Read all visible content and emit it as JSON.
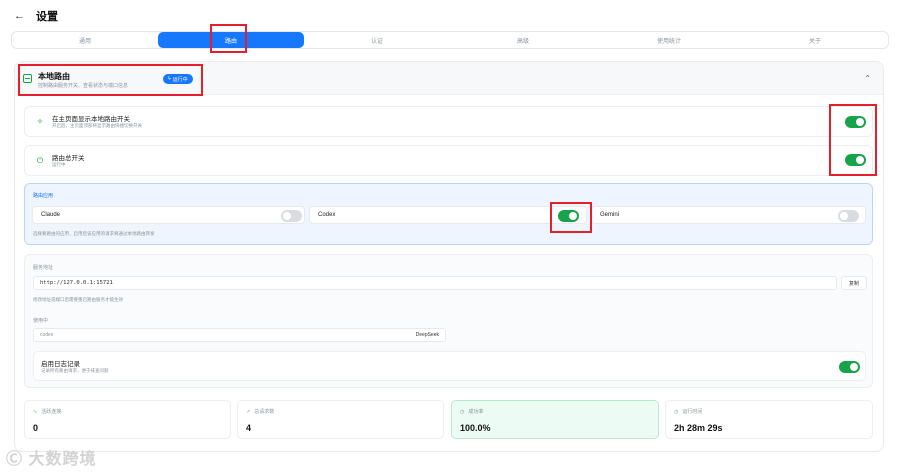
{
  "header": {
    "back_icon": "arrow-left-icon",
    "title": "设置"
  },
  "tabs": [
    {
      "label": "通用",
      "active": false
    },
    {
      "label": "路由",
      "active": true
    },
    {
      "label": "认证",
      "active": false
    },
    {
      "label": "高级",
      "active": false
    },
    {
      "label": "使用统计",
      "active": false
    },
    {
      "label": "关于",
      "active": false
    }
  ],
  "local_router": {
    "title": "本地路由",
    "subtitle": "控制路由服务开关、查看状态与端口信息",
    "badge": "运行中",
    "collapse_icon": "chevron-up-icon"
  },
  "settings": [
    {
      "title": "在主页面显示本地路由开关",
      "desc": "开启后，主页面顶部将显示路由快捷切换开关",
      "enabled": true,
      "icon": "sparkle-icon"
    },
    {
      "title": "路由总开关",
      "desc": "运行中",
      "enabled": true,
      "icon": "power-icon"
    }
  ],
  "route_apps": {
    "label": "路由应用",
    "apps": [
      {
        "name": "Claude",
        "enabled": false
      },
      {
        "name": "Codex",
        "enabled": true
      },
      {
        "name": "Gemini",
        "enabled": false
      }
    ],
    "hint": "选择要路由的应用，启用后该应用的请求将通过本地路由转发"
  },
  "service": {
    "address_label": "服务地址",
    "address": "http://127.0.0.1:15721",
    "copy_label": "复制",
    "address_note": "修改地址或端口后需要重启路由服务才能生效",
    "in_use_label": "使用中",
    "in_use_app": "codex",
    "in_use_provider": "DeepSeek",
    "log_title": "启用日志记录",
    "log_desc": "记录所有路由请求，便于排查问题",
    "log_enabled": true
  },
  "stats": [
    {
      "label": "活跃连接",
      "value": "0",
      "icon": "activity-icon"
    },
    {
      "label": "总请求数",
      "value": "4",
      "icon": "trend-up-icon"
    },
    {
      "label": "成功率",
      "value": "100.0%",
      "icon": "clock-icon"
    },
    {
      "label": "运行时间",
      "value": "2h 28m 29s",
      "icon": "clock-icon"
    }
  ],
  "watermark": "大数跨境",
  "colors": {
    "accent": "#1677ff",
    "success": "#17a34a",
    "highlight": "#e5202a"
  }
}
